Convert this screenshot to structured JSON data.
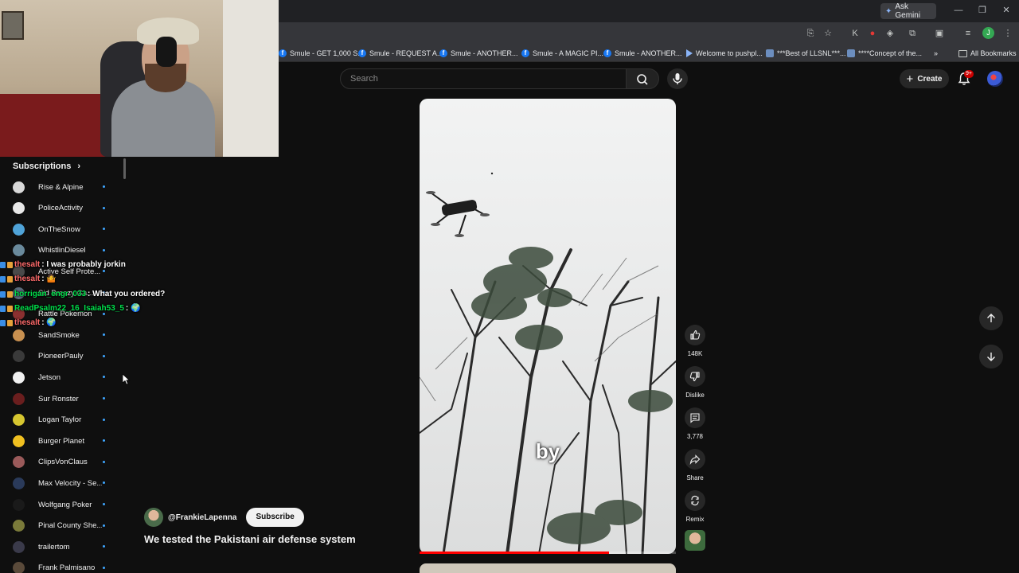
{
  "browser": {
    "ask_gemini": "Ask Gemini",
    "bookmarks": [
      {
        "label": "Smule - GET 1,000 S...",
        "icon": "facebook-icon"
      },
      {
        "label": "Smule - REQUEST A...",
        "icon": "facebook-icon"
      },
      {
        "label": "Smule - ANOTHER...",
        "icon": "facebook-icon"
      },
      {
        "label": "Smule - A MAGIC PI...",
        "icon": "facebook-icon"
      },
      {
        "label": "Smule - ANOTHER...",
        "icon": "facebook-icon"
      },
      {
        "label": "Welcome to pushpl...",
        "icon": "arrow-icon"
      },
      {
        "label": "***Best of LLSNL***...",
        "icon": "page-icon"
      },
      {
        "label": "****Concept of the...",
        "icon": "page-icon"
      }
    ],
    "all_bookmarks": "All Bookmarks",
    "profile_initial": "J",
    "more_bookmarks": "»"
  },
  "header": {
    "search_placeholder": "Search",
    "create_label": "Create",
    "notification_count": "9+"
  },
  "sidebar": {
    "section_title": "Subscriptions",
    "section_chevron": "›",
    "items": [
      {
        "label": "Rise & Alpine",
        "color": "#d8d8d8"
      },
      {
        "label": "PoliceActivity",
        "color": "#e8e8e8"
      },
      {
        "label": "OnTheSnow",
        "color": "#4fa3d8"
      },
      {
        "label": "WhistlinDiesel",
        "color": "#6a8a9c"
      },
      {
        "label": "Active Self Prote...",
        "color": "#4a4a4a"
      },
      {
        "label": "Sid Breezy Ga...",
        "color": "#5a6a7a"
      },
      {
        "label": "Rattle Pokemon",
        "color": "#8a3030"
      },
      {
        "label": "SandSmoke",
        "color": "#c89050"
      },
      {
        "label": "PioneerPauly",
        "color": "#3a3a3a"
      },
      {
        "label": "Jetson",
        "color": "#f1f1f1"
      },
      {
        "label": "Sur Ronster",
        "color": "#6a1e1e"
      },
      {
        "label": "Logan Taylor",
        "color": "#d6c630"
      },
      {
        "label": "Burger Planet",
        "color": "#f0c020"
      },
      {
        "label": "ClipsVonClaus",
        "color": "#9a5a5a"
      },
      {
        "label": "Max Velocity - Se...",
        "color": "#2a3a5a"
      },
      {
        "label": "Wolfgang Poker",
        "color": "#1a1a1a"
      },
      {
        "label": "Pinal County She...",
        "color": "#7a7a3a"
      },
      {
        "label": "trailertom",
        "color": "#3a3a4a"
      },
      {
        "label": "Frank Palmisano",
        "color": "#5a4a3a"
      }
    ]
  },
  "chat": [
    {
      "user": "thesalt",
      "message": ": I was probably jorkin",
      "user_color": "#ff6b6b"
    },
    {
      "user": "thesalt",
      "message": ": 🤷",
      "user_color": "#ff6b6b"
    },
    {
      "user": "horrigan_engr_033",
      "message": ": What you ordered?",
      "user_color": "#00e04b"
    },
    {
      "user": "ReadPsalm22_16_Isaiah53_5",
      "message": ": 🌍",
      "user_color": "#00e04b"
    },
    {
      "user": "thesalt",
      "message": ": 🌍",
      "user_color": "#ff6b6b"
    }
  ],
  "short": {
    "caption": "by",
    "channel_handle": "@FrankieLapenna",
    "subscribe_label": "Subscribe",
    "title": "We tested the Pakistani air defense system",
    "progress": 0.74,
    "actions": {
      "like_count": "148K",
      "dislike_label": "Dislike",
      "comment_count": "3,778",
      "share_label": "Share",
      "remix_label": "Remix"
    }
  },
  "colors": {
    "page_bg": "#0f0f0f",
    "accent_red": "#ff0000",
    "link_blue": "#3ea6ff"
  }
}
